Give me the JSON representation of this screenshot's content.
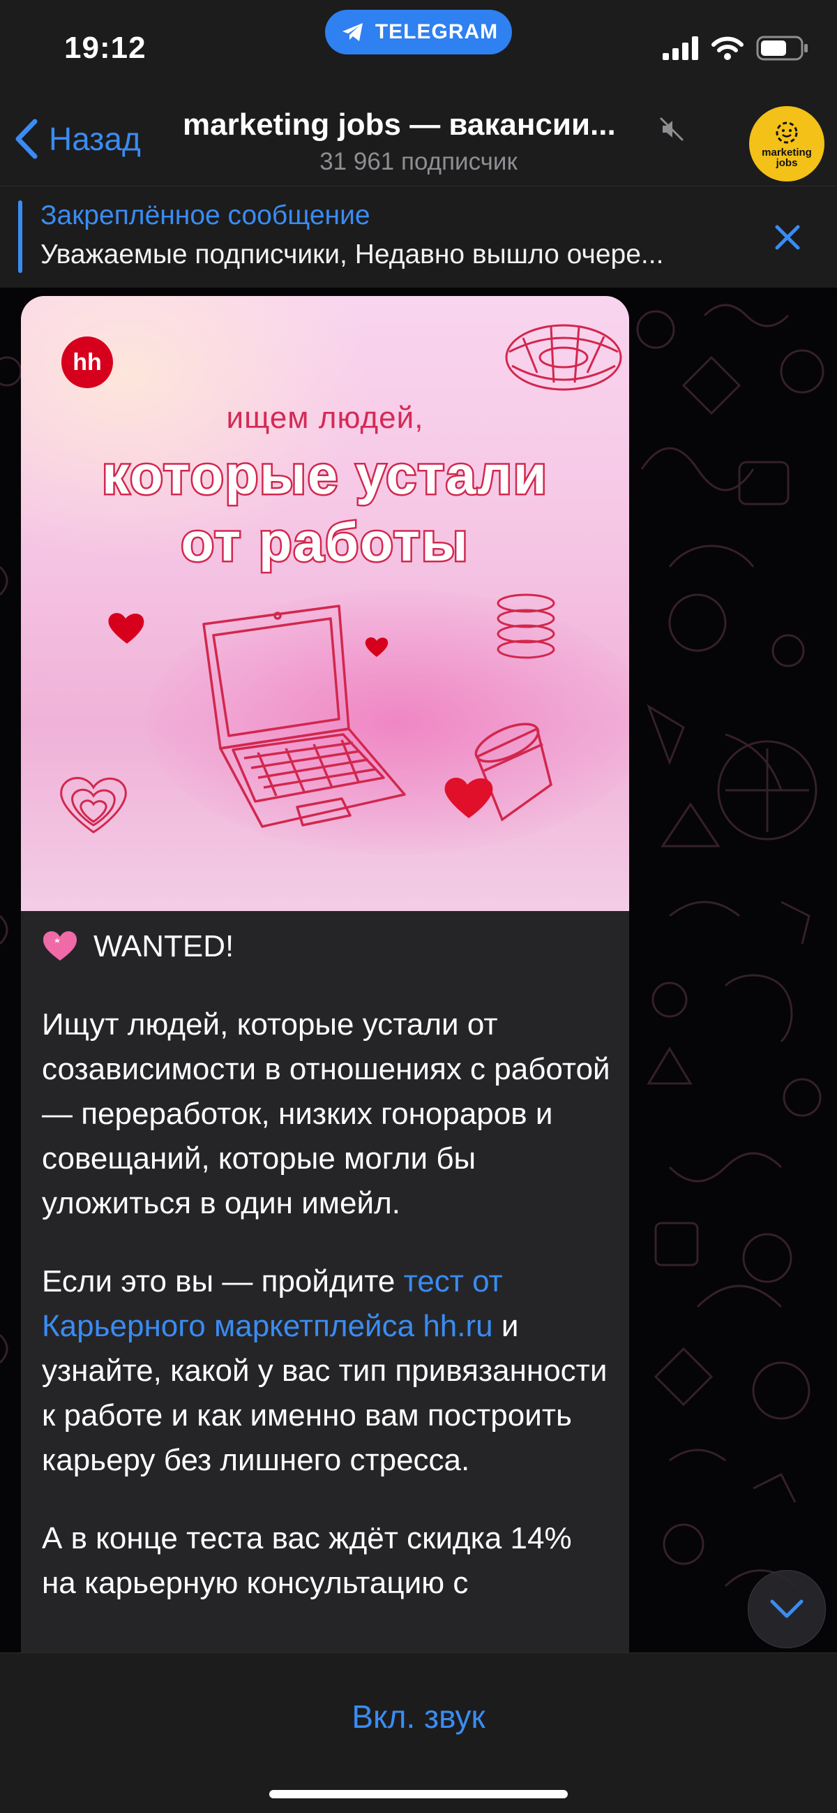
{
  "status_bar": {
    "time": "19:12",
    "pill_label": "TELEGRAM",
    "icons": [
      "signal-icon",
      "wifi-icon",
      "battery-icon"
    ]
  },
  "header": {
    "back_label": "Назад",
    "title": "marketing jobs — вакансии...",
    "subtitle": "31 961 подписчик",
    "avatar_text": "marketing jobs",
    "muted_icon": "mute-icon"
  },
  "pinned": {
    "title": "Закреплённое сообщение",
    "text": "Уважаемые подписчики, Недавно вышло очере..."
  },
  "post": {
    "image": {
      "logo": "hh",
      "subtitle": "ищем людей,",
      "headline_line1": "которые устали",
      "headline_line2": "от работы"
    },
    "wanted": "WANTED!",
    "paragraph1": "Ищут людей, которые устали от созависимости в отношениях с работой — переработок, низких гонораров и совещаний, которые могли бы уложиться в один имейл.",
    "paragraph2_before": "Если это вы — пройдите ",
    "paragraph2_link": "тест от Карьерного маркетплейса hh.ru",
    "paragraph2_after": " и узнайте, какой у вас тип привязанности к работе и как именно вам построить карьеру без лишнего стресса.",
    "paragraph3": "А в конце теста вас ждёт скидка 14% на карьерную консультацию с"
  },
  "bottom": {
    "unmute_label": "Вкл. звук"
  },
  "colors": {
    "accent": "#3a8cf2",
    "bar_bg": "#1c1c1d",
    "bubble_bg": "#252528",
    "avatar_bg": "#f3c117",
    "poster_red": "#d2274d"
  }
}
